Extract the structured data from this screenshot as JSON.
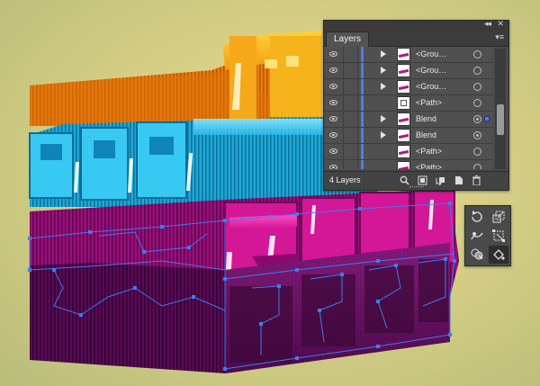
{
  "layers_panel": {
    "tab_label": "Layers",
    "collapse_glyph": "◂◂",
    "close_glyph": "✕",
    "menu_glyph": "▾≡",
    "rows": [
      {
        "name": "<Grou…",
        "has_arrow": true,
        "thumb": "stroke",
        "targeted": false,
        "selected": false
      },
      {
        "name": "<Grou…",
        "has_arrow": true,
        "thumb": "stroke",
        "targeted": false,
        "selected": false
      },
      {
        "name": "<Grou…",
        "has_arrow": true,
        "thumb": "stroke",
        "targeted": false,
        "selected": false
      },
      {
        "name": "<Path>",
        "has_arrow": false,
        "thumb": "path",
        "targeted": false,
        "selected": false
      },
      {
        "name": "Blend",
        "has_arrow": true,
        "thumb": "stroke",
        "targeted": true,
        "selected": true
      },
      {
        "name": "Blend",
        "has_arrow": true,
        "thumb": "stroke",
        "targeted": true,
        "selected": false
      },
      {
        "name": "<Path>",
        "has_arrow": false,
        "thumb": "stroke",
        "targeted": false,
        "selected": false
      },
      {
        "name": "<Path>",
        "has_arrow": false,
        "thumb": "stroke",
        "targeted": false,
        "selected": false
      }
    ],
    "layer_count": "4 Layers",
    "footer_icons": [
      "locate-object-icon",
      "make-clipping-mask-icon",
      "create-sublayer-icon",
      "new-layer-icon",
      "delete-icon"
    ],
    "layer_color": "#4f7fe6"
  },
  "tools_panel": {
    "tools": [
      "rotate-tool-icon",
      "scale-tool-icon",
      "warp-tool-icon",
      "free-transform-tool-icon",
      "shape-builder-tool-icon",
      "live-paint-bucket-tool-icon"
    ]
  },
  "artwork": {
    "colors": {
      "orange": "#f08a10",
      "cyan": "#2ec4ec",
      "magenta": "#c0128c",
      "purple": "#5a0a55",
      "selection": "#3f7bf0"
    }
  }
}
